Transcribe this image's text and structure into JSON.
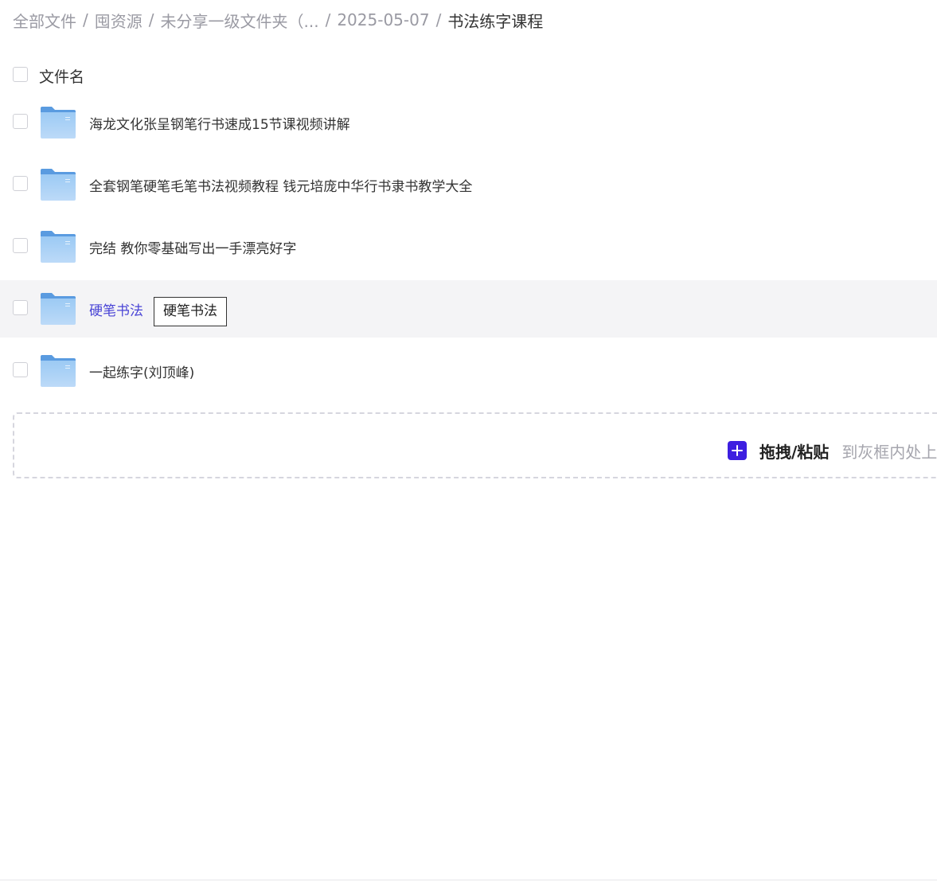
{
  "breadcrumb": {
    "items": [
      "全部文件",
      "囤资源",
      "未分享一级文件夹（...",
      "2025-05-07",
      "书法练字课程"
    ],
    "separator": "/"
  },
  "list": {
    "column_title": "文件名",
    "rows": [
      {
        "name": "海龙文化张呈钢笔行书速成15节课视频讲解",
        "icon": "folder-icon"
      },
      {
        "name": "全套钢笔硬笔毛笔书法视频教程 钱元培庞中华行书隶书教学大全",
        "icon": "folder-icon"
      },
      {
        "name": "完结 教你零基础写出一手漂亮好字",
        "icon": "folder-icon"
      },
      {
        "name": "硬笔书法",
        "icon": "folder-icon",
        "hovered": true
      },
      {
        "name": "一起练字(刘顶峰)",
        "icon": "folder-icon"
      }
    ]
  },
  "tooltip": {
    "text": "硬笔书法"
  },
  "drop_zone": {
    "icon": "plus-icon",
    "action_label": "拖拽/粘贴",
    "hint": "到灰框内处上"
  },
  "colors": {
    "accent": "#3d1fe0",
    "hover_text": "#4a45d6",
    "hover_row": "#f4f4f6",
    "folder": "#7ab3ea"
  }
}
